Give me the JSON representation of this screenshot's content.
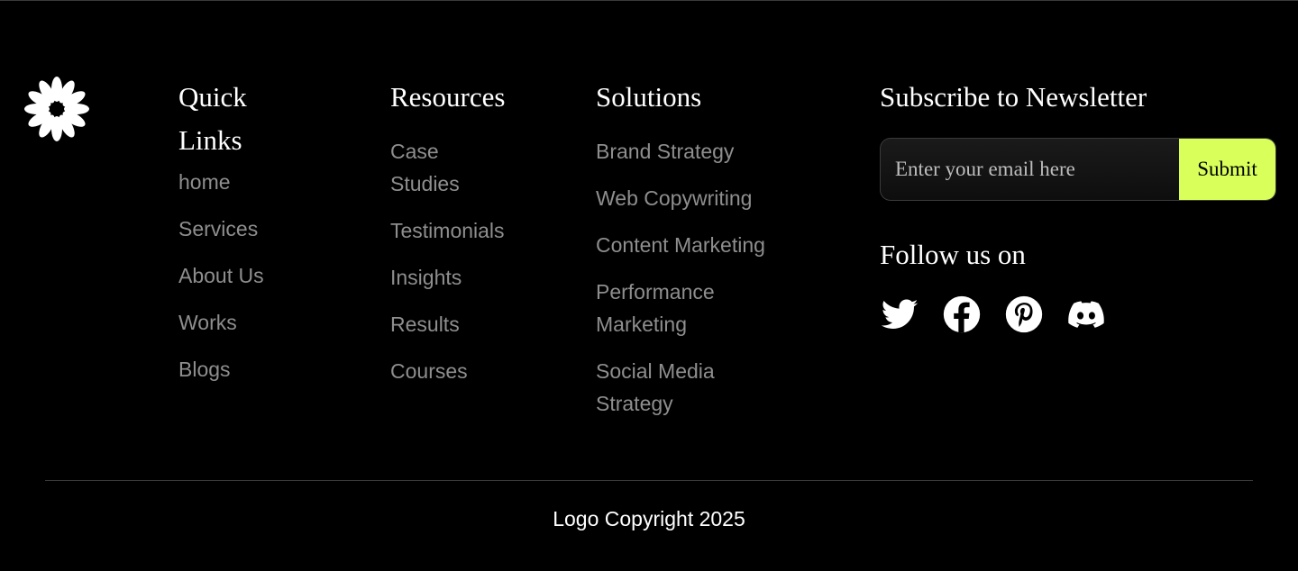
{
  "footer": {
    "logo_icon": "flower-burst-icon",
    "quick_links": {
      "title": "Quick Links",
      "items": [
        "home",
        "Services",
        "About Us",
        "Works",
        "Blogs"
      ]
    },
    "resources": {
      "title": "Resources",
      "items": [
        "Case Studies",
        "Testimonials",
        "Insights",
        "Results",
        "Courses"
      ]
    },
    "solutions": {
      "title": "Solutions",
      "items": [
        "Brand Strategy",
        "Web Copywriting",
        "Content Marketing",
        "Performance Marketing",
        "Social Media Strategy"
      ]
    },
    "newsletter": {
      "title": "Subscribe to Newsletter",
      "email_value": "",
      "email_placeholder": "Enter your email here",
      "submit_label": "Submit",
      "accent_color": "#d8ff5a"
    },
    "follow": {
      "title": "Follow us on",
      "icons": [
        "twitter-icon",
        "facebook-icon",
        "pinterest-icon",
        "discord-icon"
      ]
    },
    "copyright": "Logo Copyright 2025"
  },
  "colors": {
    "background": "#000000",
    "heading": "#ffffff",
    "link": "#8e8e8e",
    "divider": "#3a3a3a"
  }
}
